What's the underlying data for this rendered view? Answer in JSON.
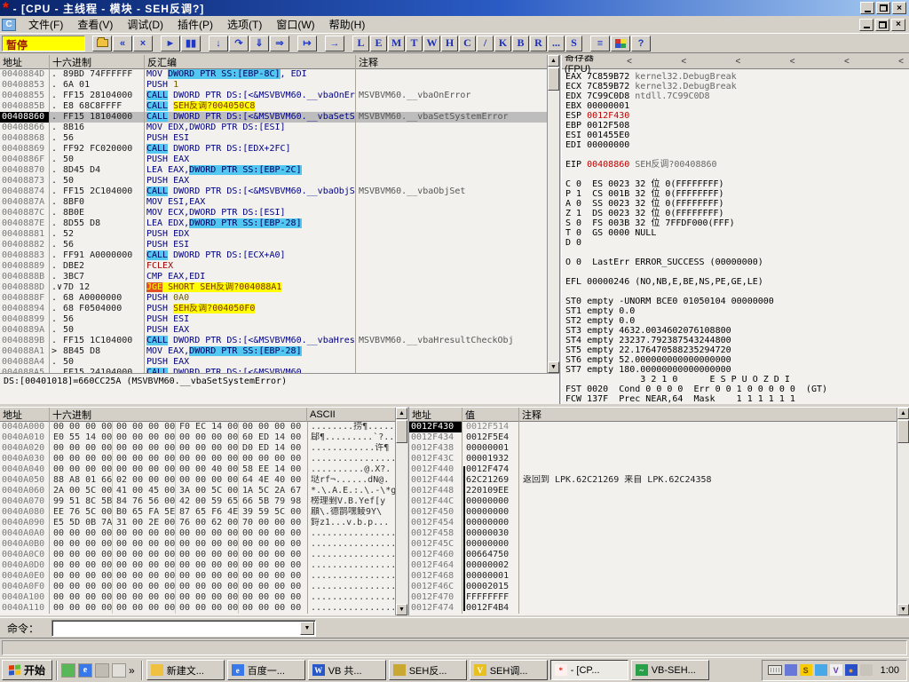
{
  "icons": {
    "up": "▲",
    "down": "▼",
    "dropdown": "▼",
    "star": "*",
    "child": "C",
    "overflow": "»"
  },
  "window": {
    "title": "- [CPU - 主线程 - 模块 - SEH反调?]"
  },
  "menu": {
    "items": [
      "文件(F)",
      "查看(V)",
      "调试(D)",
      "插件(P)",
      "选项(T)",
      "窗口(W)",
      "帮助(H)"
    ]
  },
  "toolbar": {
    "status": "暂停",
    "buttons": [
      {
        "name": "open-file-button",
        "glyph": "folder",
        "group": 1
      },
      {
        "name": "restart-button",
        "glyph": "«",
        "group": 1
      },
      {
        "name": "close-process-button",
        "glyph": "×",
        "group": 1
      },
      {
        "name": "run-button",
        "glyph": "►",
        "group": 2
      },
      {
        "name": "pause-button",
        "glyph": "▮▮",
        "group": 2
      },
      {
        "name": "step-into-button",
        "glyph": "↓",
        "group": 3
      },
      {
        "name": "step-over-button",
        "glyph": "↷",
        "group": 3
      },
      {
        "name": "animate-into-button",
        "glyph": "⇓",
        "group": 3
      },
      {
        "name": "animate-over-button",
        "glyph": "⇒",
        "group": 3
      },
      {
        "name": "execute-till-return-button",
        "glyph": "↦",
        "group": 4
      },
      {
        "name": "go-to-button",
        "glyph": "→",
        "group": 5
      }
    ],
    "letter_buttons": [
      "L",
      "E",
      "M",
      "T",
      "W",
      "H",
      "C",
      "/",
      "K",
      "B",
      "R",
      "...",
      "S"
    ],
    "end_buttons": [
      {
        "name": "windows-list-button",
        "glyph": "≡"
      },
      {
        "name": "appearance-button",
        "glyph": "palette"
      },
      {
        "name": "help-button",
        "glyph": "?"
      }
    ]
  },
  "disasm": {
    "headers": [
      "地址",
      "十六进制",
      "反汇编",
      "注释"
    ],
    "rows": [
      {
        "a": "0040884D",
        "f": ".",
        "h": "89BD 74FFFFFF",
        "p": [
          [
            "MOV ",
            "p"
          ],
          [
            "DWORD PTR SS:[EBP-8C]",
            "c"
          ],
          [
            ", EDI",
            "p"
          ]
        ]
      },
      {
        "a": "00408853",
        "f": ".",
        "h": "6A 01",
        "p": [
          [
            "PUSH ",
            "p"
          ],
          [
            "1",
            "o"
          ]
        ]
      },
      {
        "a": "00408855",
        "f": ".",
        "h": "FF15 28104000",
        "p": [
          [
            "CALL",
            "c"
          ],
          [
            " DWORD PTR DS:[<&MSVBVM60.__vbaOnError",
            "p"
          ]
        ],
        "c": "MSVBVM60.__vbaOnError"
      },
      {
        "a": "0040885B",
        "f": ".",
        "h": "E8 68C8FFFF",
        "p": [
          [
            "CALL",
            "c"
          ],
          [
            " ",
            "p"
          ],
          [
            "SEH反调?004050C8",
            "y"
          ]
        ]
      },
      {
        "a": "00408860",
        "sel": 1,
        "f": ".",
        "h": "FF15 18104000",
        "p": [
          [
            "CALL",
            "c"
          ],
          [
            " DWORD PTR DS:[<&MSVBVM60.__vbaSetSy",
            "p"
          ]
        ],
        "c": "MSVBVM60.__vbaSetSystemError"
      },
      {
        "a": "00408866",
        "f": ".",
        "h": "8B16",
        "p": [
          [
            "MOV EDX,DWORD PTR DS:[ESI]",
            "p"
          ]
        ]
      },
      {
        "a": "00408868",
        "f": ".",
        "h": "56",
        "p": [
          [
            "PUSH ESI",
            "p"
          ]
        ]
      },
      {
        "a": "00408869",
        "f": ".",
        "h": "FF92 FC020000",
        "p": [
          [
            "CALL",
            "c"
          ],
          [
            " DWORD PTR DS:[EDX+2FC]",
            "p"
          ]
        ]
      },
      {
        "a": "0040886F",
        "f": ".",
        "h": "50",
        "p": [
          [
            "PUSH EAX",
            "p"
          ]
        ]
      },
      {
        "a": "00408870",
        "f": ".",
        "h": "8D45 D4",
        "p": [
          [
            "LEA EAX,",
            "p"
          ],
          [
            "DWORD PTR SS:[EBP-2C]",
            "c"
          ]
        ]
      },
      {
        "a": "00408873",
        "f": ".",
        "h": "50",
        "p": [
          [
            "PUSH EAX",
            "p"
          ]
        ]
      },
      {
        "a": "00408874",
        "f": ".",
        "h": "FF15 2C104000",
        "p": [
          [
            "CALL",
            "c"
          ],
          [
            " DWORD PTR DS:[<&MSVBVM60.__vbaObjSe",
            "p"
          ]
        ],
        "c": "MSVBVM60.__vbaObjSet"
      },
      {
        "a": "0040887A",
        "f": ".",
        "h": "8BF0",
        "p": [
          [
            "MOV ESI,EAX",
            "p"
          ]
        ]
      },
      {
        "a": "0040887C",
        "f": ".",
        "h": "8B0E",
        "p": [
          [
            "MOV ECX,DWORD PTR DS:[ESI]",
            "p"
          ]
        ]
      },
      {
        "a": "0040887E",
        "f": ".",
        "h": "8D55 D8",
        "p": [
          [
            "LEA EDX,",
            "p"
          ],
          [
            "DWORD PTR SS:[EBP-28]",
            "c"
          ]
        ]
      },
      {
        "a": "00408881",
        "f": ".",
        "h": "52",
        "p": [
          [
            "PUSH EDX",
            "p"
          ]
        ]
      },
      {
        "a": "00408882",
        "f": ".",
        "h": "56",
        "p": [
          [
            "PUSH ESI",
            "p"
          ]
        ]
      },
      {
        "a": "00408883",
        "f": ".",
        "h": "FF91 A0000000",
        "p": [
          [
            "CALL",
            "c"
          ],
          [
            " DWORD PTR DS:[ECX+A0]",
            "p"
          ]
        ]
      },
      {
        "a": "00408889",
        "f": ".",
        "h": "DBE2",
        "p": [
          [
            "FCLEX",
            "r"
          ]
        ]
      },
      {
        "a": "0040888B",
        "f": ".",
        "h": "3BC7",
        "p": [
          [
            "CMP EAX,EDI",
            "p"
          ]
        ]
      },
      {
        "a": "0040888D",
        "f": ".∨",
        "h": "7D 12",
        "p": [
          [
            "JGE",
            "j"
          ],
          [
            " SHORT SEH反调?004088A1",
            "y"
          ]
        ]
      },
      {
        "a": "0040888F",
        "f": ".",
        "h": "68 A0000000",
        "p": [
          [
            "PUSH ",
            "p"
          ],
          [
            "0A0",
            "o"
          ]
        ]
      },
      {
        "a": "00408894",
        "f": ".",
        "h": "68 F0504000",
        "p": [
          [
            "PUSH ",
            "p"
          ],
          [
            "SEH反调?004050F0",
            "y"
          ]
        ]
      },
      {
        "a": "00408899",
        "f": ".",
        "h": "56",
        "p": [
          [
            "PUSH ESI",
            "p"
          ]
        ]
      },
      {
        "a": "0040889A",
        "f": ".",
        "h": "50",
        "p": [
          [
            "PUSH EAX",
            "p"
          ]
        ]
      },
      {
        "a": "0040889B",
        "f": ".",
        "h": "FF15 1C104000",
        "p": [
          [
            "CALL",
            "c"
          ],
          [
            " DWORD PTR DS:[<&MSVBVM60.__vbaHresu",
            "p"
          ]
        ],
        "c": "MSVBVM60.__vbaHresultCheckObj"
      },
      {
        "a": "004088A1",
        "f": ">",
        "h": "8B45 D8",
        "p": [
          [
            "MOV EAX,",
            "p"
          ],
          [
            "DWORD PTR SS:[EBP-28]",
            "c"
          ]
        ]
      },
      {
        "a": "004088A4",
        "f": ".",
        "h": "50",
        "p": [
          [
            "PUSH EAX",
            "p"
          ]
        ]
      },
      {
        "a": "004088A5",
        "f": ".",
        "h": "FF15 24104000",
        "p": [
          [
            "CALL",
            "c"
          ],
          [
            " DWORD PTR DS:[<&MSVBVM60",
            "p"
          ]
        ]
      }
    ],
    "info_line": "DS:[00401018]=660CC25A (MSVBVM60.__vbaSetSystemError)"
  },
  "registers": {
    "title": "寄存器 (FPU)",
    "header_marks": [
      "<",
      "<",
      "<",
      "<",
      "<",
      "<"
    ],
    "lines": [
      [
        [
          "EAX 7C859B72 ",
          "k"
        ],
        [
          "kernel32.DebugBreak",
          "g"
        ]
      ],
      [
        [
          "ECX 7C859B72 ",
          "k"
        ],
        [
          "kernel32.DebugBreak",
          "g"
        ]
      ],
      [
        [
          "EDX 7C99C0D8 ",
          "k"
        ],
        [
          "ntdll.7C99C0D8",
          "g"
        ]
      ],
      [
        [
          "EBX 00000001",
          "k"
        ]
      ],
      [
        [
          "ESP ",
          "k"
        ],
        [
          "0012F430",
          "r"
        ]
      ],
      [
        [
          "EBP 0012F508",
          "k"
        ]
      ],
      [
        [
          "ESI 001455E0",
          "k"
        ]
      ],
      [
        [
          "EDI 00000000",
          "k"
        ]
      ],
      [],
      [
        [
          "EIP ",
          "k"
        ],
        [
          "00408860",
          "r"
        ],
        [
          " SEH反调?00408860",
          "g"
        ]
      ],
      [],
      [
        [
          "C 0  ES 0023 32 位 0(FFFFFFFF)",
          "k"
        ]
      ],
      [
        [
          "P 1  CS 001B 32 位 0(FFFFFFFF)",
          "k"
        ]
      ],
      [
        [
          "A 0  SS 0023 32 位 0(FFFFFFFF)",
          "k"
        ]
      ],
      [
        [
          "Z 1  DS 0023 32 位 0(FFFFFFFF)",
          "k"
        ]
      ],
      [
        [
          "S 0  FS 003B 32 位 7FFDF000(FFF)",
          "k"
        ]
      ],
      [
        [
          "T 0  GS 0000 NULL",
          "k"
        ]
      ],
      [
        [
          "D 0",
          "k"
        ]
      ],
      [],
      [
        [
          "O 0  LastErr ERROR_SUCCESS (00000000)",
          "k"
        ]
      ],
      [],
      [
        [
          "EFL 00000246 (NO,NB,E,BE,NS,PE,GE,LE)",
          "k"
        ]
      ],
      [],
      [
        [
          "ST0 empty -UNORM BCE0 01050104 00000000",
          "k"
        ]
      ],
      [
        [
          "ST1 empty 0.0",
          "k"
        ]
      ],
      [
        [
          "ST2 empty 0.0",
          "k"
        ]
      ],
      [
        [
          "ST3 empty 4632.0034602076108800",
          "k"
        ]
      ],
      [
        [
          "ST4 empty 23237.792387543244800",
          "k"
        ]
      ],
      [
        [
          "ST5 empty 22.176470588235294720",
          "k"
        ]
      ],
      [
        [
          "ST6 empty 52.000000000000000000",
          "k"
        ]
      ],
      [
        [
          "ST7 empty 180.00000000000000000",
          "k"
        ]
      ],
      [
        [
          "              3 2 1 0      E S P U O Z D I",
          "k"
        ]
      ],
      [
        [
          "FST 0020  Cond 0 0 0 0  Err 0 0 1 0 0 0 0 0  (GT)",
          "k"
        ]
      ],
      [
        [
          "FCW 137F  Prec NEAR,64  Mask    1 1 1 1 1 1",
          "k"
        ]
      ]
    ]
  },
  "dump": {
    "headers": [
      "地址",
      "十六进制",
      "ASCII"
    ],
    "rows": [
      {
        "a": "0040A000",
        "g": [
          "00 00 00 00",
          "00 00 00 00",
          "F0 EC 14 00",
          "00 00 00 00"
        ],
        "s": "........捞¶....."
      },
      {
        "a": "0040A010",
        "g": [
          "E0 55 14 00",
          "00 00 00 00",
          "00 00 00 00",
          "60 ED 14 00"
        ],
        "s": "郈¶.........`?.."
      },
      {
        "a": "0040A020",
        "g": [
          "00 00 00 00",
          "00 00 00 00",
          "00 00 00 00",
          "D0 ED 14 00"
        ],
        "s": "............许¶"
      },
      {
        "a": "0040A030",
        "g": [
          "00 00 00 00",
          "00 00 00 00",
          "00 00 00 00",
          "00 00 00 00"
        ],
        "s": "................"
      },
      {
        "a": "0040A040",
        "g": [
          "00 00 00 00",
          "00 00 00 00",
          "00 00 40 00",
          "58 EE 14 00"
        ],
        "s": "..........@.X?."
      },
      {
        "a": "0040A050",
        "g": [
          "88 A8 01 66",
          "02 00 00 00",
          "00 00 00 00",
          "64 4E 40 00"
        ],
        "s": "垯rf¬......dN@."
      },
      {
        "a": "0040A060",
        "g": [
          "2A 00 5C 00",
          "41 00 45 00",
          "3A 00 5C 00",
          "1A 5C 2A 67"
        ],
        "s": "*.\\.A.E.:.\\.-\\*g"
      },
      {
        "a": "0040A070",
        "g": [
          "99 51 8C 5B",
          "84 76 56 00",
          "42 00 59 65",
          "66 5B 79 98"
        ],
        "s": "榜理剉V.B.Yef[y"
      },
      {
        "a": "0040A080",
        "g": [
          "EE 76 5C 00",
          "B0 65 FA 5E",
          "87 65 F6 4E",
          "39 59 5C 00"
        ],
        "s": "顅\\.德鹊嘿鲮9Y\\"
      },
      {
        "a": "0040A090",
        "g": [
          "E5 5D 0B 7A",
          "31 00 2E 00",
          "76 00 62 00",
          "70 00 00 00"
        ],
        "s": "鋝z1...v.b.p..."
      },
      {
        "a": "0040A0A0",
        "g": [
          "00 00 00 00",
          "00 00 00 00",
          "00 00 00 00",
          "00 00 00 00"
        ],
        "s": "................"
      },
      {
        "a": "0040A0B0",
        "g": [
          "00 00 00 00",
          "00 00 00 00",
          "00 00 00 00",
          "00 00 00 00"
        ],
        "s": "................"
      },
      {
        "a": "0040A0C0",
        "g": [
          "00 00 00 00",
          "00 00 00 00",
          "00 00 00 00",
          "00 00 00 00"
        ],
        "s": "................"
      },
      {
        "a": "0040A0D0",
        "g": [
          "00 00 00 00",
          "00 00 00 00",
          "00 00 00 00",
          "00 00 00 00"
        ],
        "s": "................"
      },
      {
        "a": "0040A0E0",
        "g": [
          "00 00 00 00",
          "00 00 00 00",
          "00 00 00 00",
          "00 00 00 00"
        ],
        "s": "................"
      },
      {
        "a": "0040A0F0",
        "g": [
          "00 00 00 00",
          "00 00 00 00",
          "00 00 00 00",
          "00 00 00 00"
        ],
        "s": "................"
      },
      {
        "a": "0040A100",
        "g": [
          "00 00 00 00",
          "00 00 00 00",
          "00 00 00 00",
          "00 00 00 00"
        ],
        "s": "................"
      },
      {
        "a": "0040A110",
        "g": [
          "00 00 00 00",
          "00 00 00 00",
          "00 00 00 00",
          "00 00 00 00"
        ],
        "s": "................"
      }
    ]
  },
  "stack": {
    "headers": [
      "地址",
      "值",
      "注释"
    ],
    "rows": [
      {
        "a": "0012F430",
        "v": "0012F514",
        "sel": 1,
        "dim": 1
      },
      {
        "a": "0012F434",
        "v": "0012F5E4"
      },
      {
        "a": "0012F438",
        "v": "00000001"
      },
      {
        "a": "0012F43C",
        "v": "00001932"
      },
      {
        "a": "0012F440",
        "v": "0012F474",
        "br": "start"
      },
      {
        "a": "0012F444",
        "v": "62C21269",
        "br": "mid",
        "c": "返回到 LPK.62C21269 来自 LPK.62C24358"
      },
      {
        "a": "0012F448",
        "v": "220109EE",
        "br": "mid"
      },
      {
        "a": "0012F44C",
        "v": "00000000",
        "br": "mid"
      },
      {
        "a": "0012F450",
        "v": "00000000",
        "br": "mid"
      },
      {
        "a": "0012F454",
        "v": "00000000",
        "br": "mid"
      },
      {
        "a": "0012F458",
        "v": "00000030",
        "br": "mid"
      },
      {
        "a": "0012F45C",
        "v": "00000000",
        "br": "mid"
      },
      {
        "a": "0012F460",
        "v": "00664750",
        "br": "mid"
      },
      {
        "a": "0012F464",
        "v": "00000002",
        "br": "mid"
      },
      {
        "a": "0012F468",
        "v": "00000001",
        "br": "mid"
      },
      {
        "a": "0012F46C",
        "v": "00002015",
        "br": "mid"
      },
      {
        "a": "0012F470",
        "v": "FFFFFFFF",
        "br": "mid"
      },
      {
        "a": "0012F474",
        "v": "0012F4B4",
        "br": "end"
      }
    ]
  },
  "command": {
    "label": "命令：",
    "value": ""
  },
  "taskbar": {
    "start_label": "开始",
    "quick_launch": [
      {
        "name": "quick-launch-icon-1",
        "color": "#58B858",
        "ch": ""
      },
      {
        "name": "quick-launch-icon-2",
        "color": "#3878E8",
        "ch": "e"
      },
      {
        "name": "quick-launch-icon-3",
        "color": "#C0BCB4",
        "ch": ""
      },
      {
        "name": "quick-launch-icon-4",
        "color": "#E0DED8",
        "ch": ""
      }
    ],
    "tasks": [
      {
        "label": "新建文...",
        "icon_color": "#F0C040",
        "ch": ""
      },
      {
        "label": "百度一...",
        "icon_color": "#3878E8",
        "ch": "e"
      },
      {
        "label": "VB 共...",
        "icon_color": "#2858C8",
        "ch": "W"
      },
      {
        "label": "SEH反...",
        "icon_color": "#C8A830",
        "ch": ""
      },
      {
        "label": "SEH调...",
        "icon_color": "#E8C020",
        "ch": "V"
      },
      {
        "label": "- [CP...",
        "icon_color": "#FFF0F0",
        "ch": "*",
        "ch_color": "#D82818",
        "active": 1
      },
      {
        "label": "VB-SEH...",
        "icon_color": "#28A048",
        "ch": "~"
      }
    ],
    "tray_icons": [
      {
        "name": "tray-icon-1",
        "color": "#6878D8",
        "ch": ""
      },
      {
        "name": "tray-icon-2",
        "color": "#F8CC00",
        "ch": "S",
        "ch_color": "#704800"
      },
      {
        "name": "tray-icon-3",
        "color": "#48A8E8",
        "ch": ""
      },
      {
        "name": "tray-icon-4",
        "color": "#F0F0F0",
        "ch": "V",
        "ch_color": "#6038A8"
      },
      {
        "name": "tray-icon-5",
        "color": "#2850C8",
        "ch": "●",
        "ch_color": "#F0A020"
      },
      {
        "name": "tray-icon-6",
        "color": "#C8C4BC",
        "ch": ""
      }
    ],
    "clock": "1:00"
  }
}
